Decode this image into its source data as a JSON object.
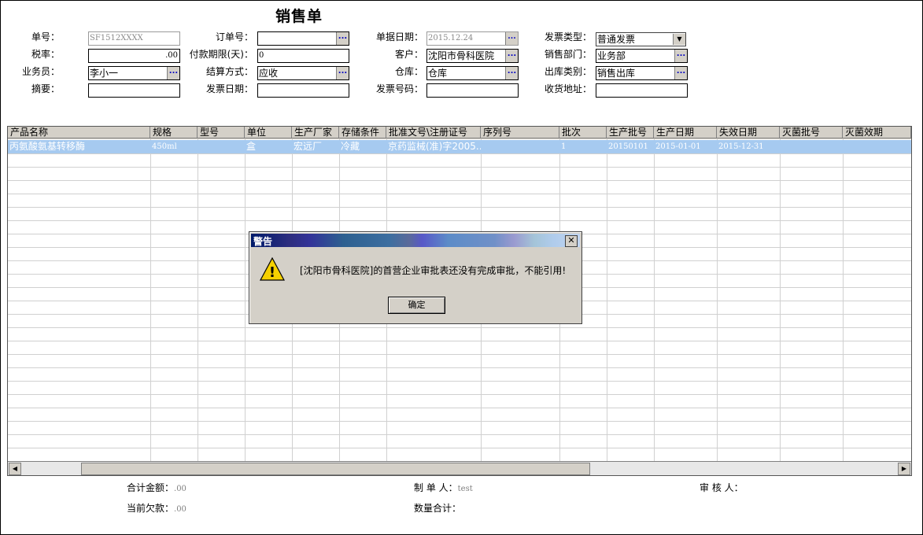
{
  "page_title": "销售单",
  "form": {
    "order_no": {
      "label": "单号：",
      "value": "SF1512XXXX"
    },
    "sub_order_no": {
      "label": "订单号：",
      "value": ""
    },
    "doc_date": {
      "label": "单据日期：",
      "value": "2015.12.24"
    },
    "invoice_type": {
      "label": "发票类型：",
      "value": "普通发票"
    },
    "tax_rate": {
      "label": "税率：",
      "value": ".00"
    },
    "payment_days": {
      "label": "付款期限(天)：",
      "value": "0"
    },
    "customer": {
      "label": "客户：",
      "value": "沈阳市骨科医院"
    },
    "sales_dept": {
      "label": "销售部门：",
      "value": "业务部"
    },
    "salesman": {
      "label": "业务员：",
      "value": "李小一"
    },
    "settlement": {
      "label": "结算方式：",
      "value": "应收"
    },
    "warehouse": {
      "label": "仓库：",
      "value": "仓库"
    },
    "outbound_type": {
      "label": "出库类别：",
      "value": "销售出库"
    },
    "summary": {
      "label": "摘要：",
      "value": ""
    },
    "invoice_date": {
      "label": "发票日期：",
      "value": ""
    },
    "invoice_no": {
      "label": "发票号码：",
      "value": ""
    },
    "ship_address": {
      "label": "收货地址：",
      "value": ""
    },
    "ellipsis": "...",
    "dropdown_arrow": "▼"
  },
  "table": {
    "columns": [
      "产品名称",
      "规格",
      "型号",
      "单位",
      "生产厂家",
      "存储条件",
      "批准文号\\注册证号",
      "序列号",
      "批次",
      "生产批号",
      "生产日期",
      "失效日期",
      "灭菌批号",
      "灭菌效期"
    ],
    "rows": [
      [
        "丙氨酸氨基转移酶",
        "450ml",
        "",
        "盒",
        "宏远厂",
        "冷藏",
        "京药监械(准)字2005...",
        "",
        "1",
        "20150101",
        "2015-01-01",
        "2015-12-31",
        "",
        ""
      ]
    ]
  },
  "scroll": {
    "left": "◀",
    "right": "▶"
  },
  "footer": {
    "total_amount": {
      "label": "合计金额：",
      "value": ".00"
    },
    "maker": {
      "label": "制 单 人：",
      "value": "test"
    },
    "auditor": {
      "label": "审 核 人：",
      "value": ""
    },
    "current_debt": {
      "label": "当前欠款：",
      "value": ".00"
    },
    "qty_total": {
      "label": "数量合计：",
      "value": ""
    }
  },
  "dialog": {
    "title": "警告",
    "close": "✕",
    "icon_glyph": "!",
    "message": "[沈阳市骨科医院]的首营企业审批表还没有完成审批，不能引用!",
    "ok": "确定"
  },
  "colors": {
    "selection": "#a6caf0",
    "header_bg": "#d4d0c8",
    "ellipsis": "#0000c0",
    "warning_icon": "#f5d000"
  }
}
